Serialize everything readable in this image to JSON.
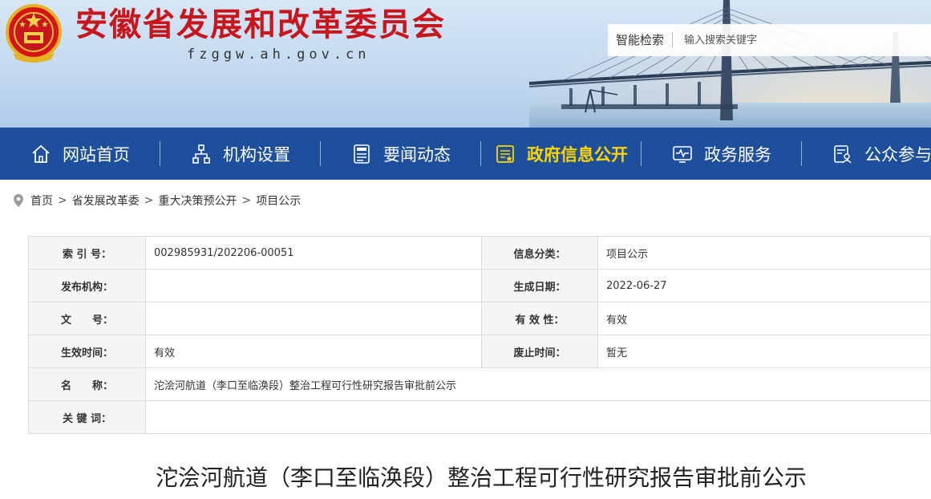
{
  "header": {
    "site_title": "安徽省发展和改革委员会",
    "site_domain": "fzggw.ah.gov.cn",
    "search_label": "智能检索",
    "search_placeholder": "输入搜索关键字"
  },
  "nav": {
    "items": [
      {
        "label": "网站首页",
        "icon": "home-icon"
      },
      {
        "label": "机构设置",
        "icon": "org-chart-icon"
      },
      {
        "label": "要闻动态",
        "icon": "news-icon"
      },
      {
        "label": "政府信息公开",
        "icon": "info-disclosure-icon",
        "active": true
      },
      {
        "label": "政务服务",
        "icon": "service-monitor-icon"
      },
      {
        "label": "公众参与",
        "icon": "public-participation-icon"
      }
    ],
    "active_color": "#ffd400",
    "bg_color": "#1d4f9d"
  },
  "breadcrumb": {
    "items": [
      "首页",
      "省发展改革委",
      "重大决策预公开",
      "项目公示"
    ],
    "separator": ">"
  },
  "meta": {
    "index_no_label": "索 引 号：",
    "index_no": "002985931/202206-00051",
    "category_label": "信息分类：",
    "category": "项目公示",
    "publisher_label": "发布机构：",
    "publisher": "",
    "created_label": "生成日期：",
    "created": "2022-06-27",
    "doc_no_label": "文　　号：",
    "doc_no": "",
    "validity_label": "有 效 性：",
    "validity": "有效",
    "effective_label": "生效时间：",
    "effective": "有效",
    "expire_label": "废止时间：",
    "expire": "暂无",
    "name_label": "名　　称：",
    "name": "沱浍河航道（李口至临涣段）整治工程可行性研究报告审批前公示",
    "keywords_label": "关 键 词：",
    "keywords": ""
  },
  "article": {
    "title": "沱浍河航道（李口至临涣段）整治工程可行性研究报告审批前公示"
  }
}
